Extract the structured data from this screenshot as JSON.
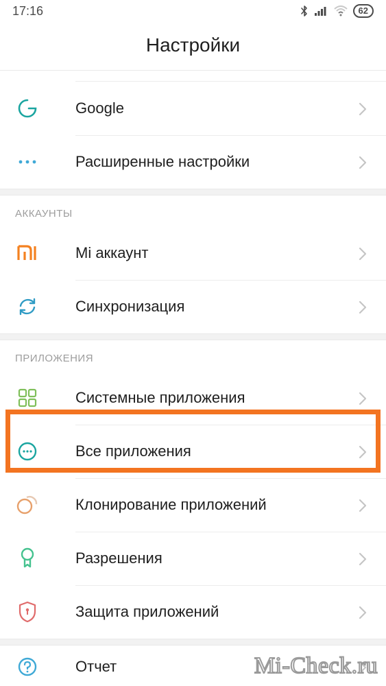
{
  "status": {
    "time": "17:16",
    "battery": "62"
  },
  "title": "Настройки",
  "groups": {
    "top": {
      "google": "Google",
      "advanced": "Расширенные настройки"
    },
    "accounts": {
      "header": "АККАУНТЫ",
      "mi": "Mi аккаунт",
      "sync": "Синхронизация"
    },
    "apps": {
      "header": "ПРИЛОЖЕНИЯ",
      "system": "Системные приложения",
      "all": "Все приложения",
      "clone": "Клонирование приложений",
      "perms": "Разрешения",
      "protect": "Защита приложений"
    },
    "bottom": {
      "report": "Отчет"
    }
  },
  "watermark": "Mi-Check.ru"
}
